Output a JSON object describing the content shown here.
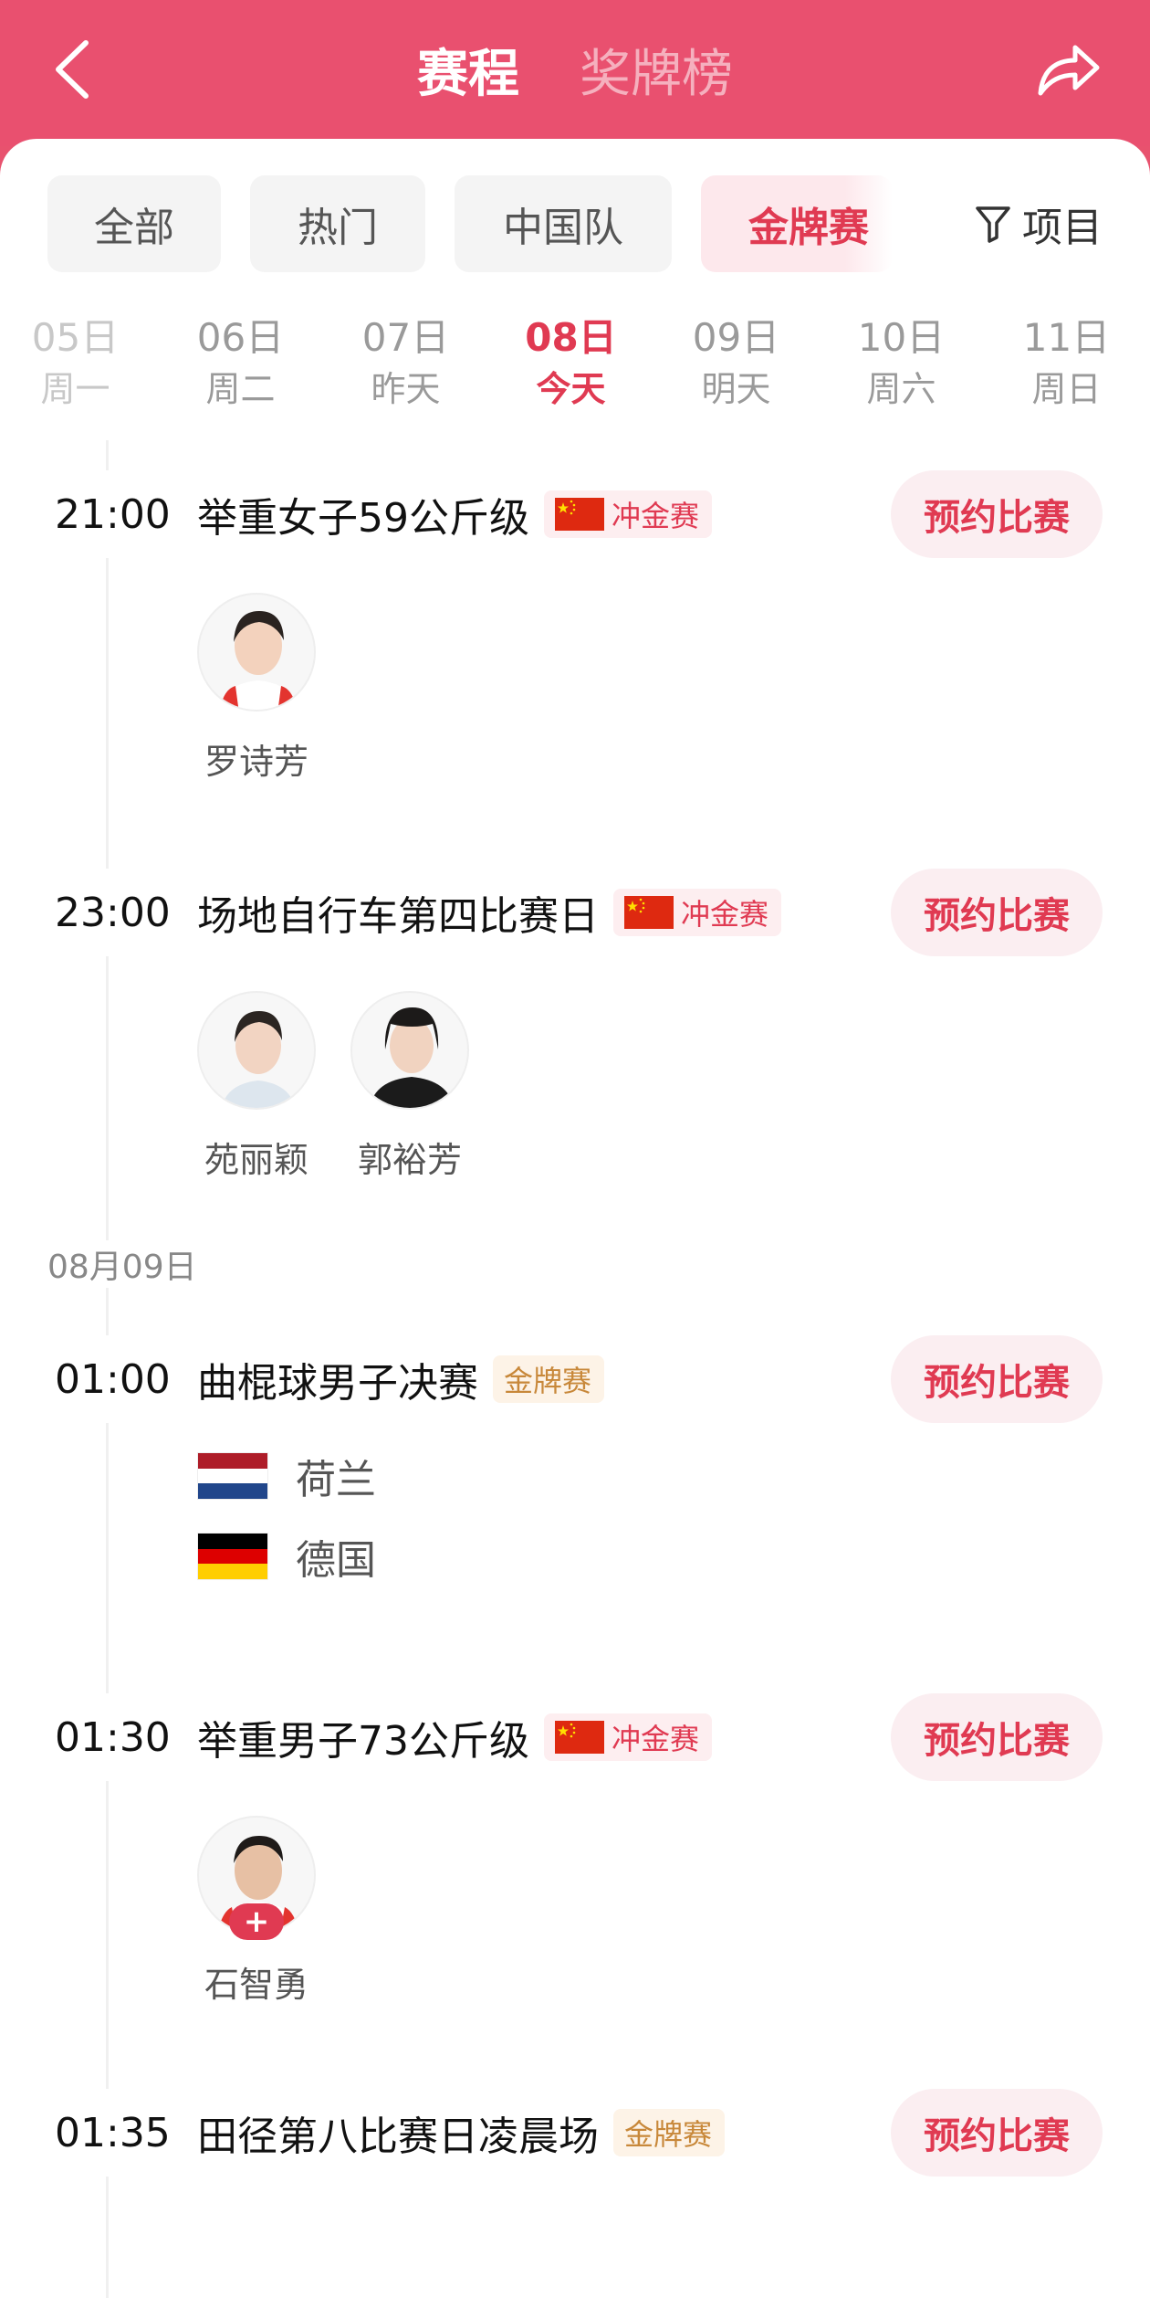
{
  "header": {
    "tabs": [
      {
        "label": "赛程",
        "active": true
      },
      {
        "label": "奖牌榜",
        "active": false
      }
    ],
    "back_icon": "chevron-left-icon",
    "share_icon": "share-arrow-icon"
  },
  "filters": {
    "chips": [
      {
        "label": "全部",
        "active": false
      },
      {
        "label": "热门",
        "active": false
      },
      {
        "label": "中国队",
        "active": false
      },
      {
        "label": "金牌赛",
        "active": true
      }
    ],
    "filter_label": "项目",
    "filter_icon": "funnel-icon"
  },
  "dates": [
    {
      "date": "05日",
      "weekday": "周一"
    },
    {
      "date": "06日",
      "weekday": "周二"
    },
    {
      "date": "07日",
      "weekday": "昨天"
    },
    {
      "date": "08日",
      "weekday": "今天",
      "active": true
    },
    {
      "date": "09日",
      "weekday": "明天"
    },
    {
      "date": "10日",
      "weekday": "周六"
    },
    {
      "date": "11日",
      "weekday": "周日"
    }
  ],
  "date_divider": "08月09日",
  "reserve_label": "预约比赛",
  "events": [
    {
      "time": "21:00",
      "title": "举重女子59公斤级",
      "tag": "冲金赛",
      "tag_type": "china",
      "athletes": [
        {
          "name": "罗诗芳"
        }
      ]
    },
    {
      "time": "23:00",
      "title": "场地自行车第四比赛日",
      "tag": "冲金赛",
      "tag_type": "china",
      "athletes": [
        {
          "name": "苑丽颖"
        },
        {
          "name": "郭裕芳"
        }
      ]
    },
    {
      "time": "01:00",
      "title": "曲棍球男子决赛",
      "tag": "金牌赛",
      "tag_type": "gold",
      "teams": [
        {
          "name": "荷兰",
          "flag_colors": [
            "#ae1c28",
            "#ffffff",
            "#21468b"
          ]
        },
        {
          "name": "德国",
          "flag_colors": [
            "#000000",
            "#dd0000",
            "#ffce00"
          ]
        }
      ]
    },
    {
      "time": "01:30",
      "title": "举重男子73公斤级",
      "tag": "冲金赛",
      "tag_type": "china",
      "athletes": [
        {
          "name": "石智勇",
          "badge": "+"
        }
      ]
    },
    {
      "time": "01:35",
      "title": "田径第八比赛日凌晨场",
      "tag": "金牌赛",
      "tag_type": "gold"
    }
  ],
  "colors": {
    "brand": "#e9506f",
    "accent_text": "#e03a52",
    "gold_tag_text": "#c8883a"
  }
}
